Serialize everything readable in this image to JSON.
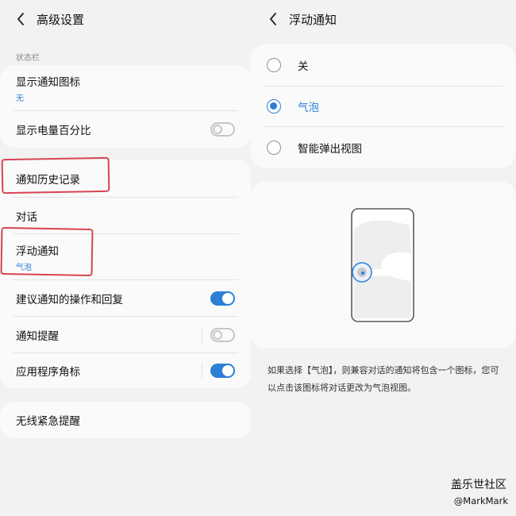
{
  "left": {
    "title": "高级设置",
    "section_label": "状态栏",
    "card1": {
      "items": [
        {
          "title": "显示通知图标",
          "subtitle": "无"
        },
        {
          "title": "显示电量百分比",
          "toggle": "off"
        }
      ]
    },
    "card2": {
      "items": [
        {
          "title": "通知历史记录"
        },
        {
          "title": "对话"
        },
        {
          "title": "浮动通知",
          "subtitle": "气泡"
        },
        {
          "title": "建议通知的操作和回复",
          "toggle": "on"
        },
        {
          "title": "通知提醒",
          "toggle": "off"
        },
        {
          "title": "应用程序角标",
          "toggle": "on"
        }
      ]
    },
    "card3": {
      "items": [
        {
          "title": "无线紧急提醒"
        }
      ]
    }
  },
  "right": {
    "title": "浮动通知",
    "options": [
      {
        "label": "关",
        "selected": false
      },
      {
        "label": "气泡",
        "selected": true
      },
      {
        "label": "智能弹出视图",
        "selected": false
      }
    ],
    "description": "如果选择【气泡】，则兼容对话的通知将包含一个图标，您可以点击该图标将对话更改为气泡视图。"
  },
  "watermark": {
    "line1": "盖乐世社区",
    "line2": "@MarkMark"
  },
  "colors": {
    "accent": "#2c7fd5",
    "annotation": "#d64550",
    "background": "#f2f2f2",
    "card": "#fafafa"
  },
  "icons": {
    "back": "chevron-left-icon",
    "radio": "radio-button-icon",
    "toggle": "toggle-switch-icon",
    "illustration": "phone-bubble-illustration"
  }
}
